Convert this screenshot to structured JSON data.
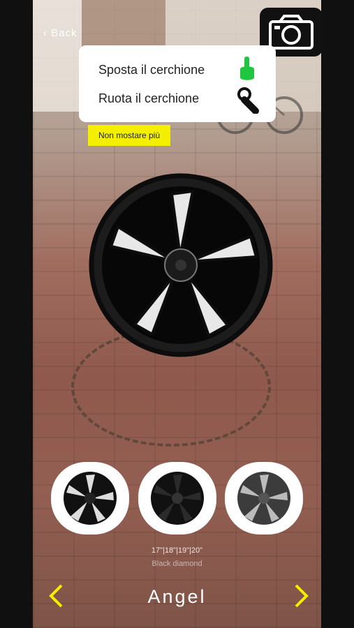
{
  "header": {
    "back_label": "Back",
    "camera_icon": "camera-icon"
  },
  "hints": {
    "move_label": "Sposta il cerchione",
    "move_icon": "hand-tap-icon",
    "rotate_label": "Ruota il cerchione",
    "rotate_icon": "hand-rotate-icon",
    "dismiss_label": "Non mostare più"
  },
  "carousel": {
    "items": [
      "wheel-variant-1",
      "wheel-variant-2",
      "wheel-variant-3"
    ]
  },
  "details": {
    "sizes": "17\"|18\"|19\"|20\"",
    "finish": "Black diamond"
  },
  "footer": {
    "model_name": "Angel",
    "prev_icon": "chevron-left-icon",
    "next_icon": "chevron-right-icon"
  },
  "colors": {
    "accent": "#f4ef00",
    "panel": "#ffffff",
    "dark": "#111111"
  }
}
